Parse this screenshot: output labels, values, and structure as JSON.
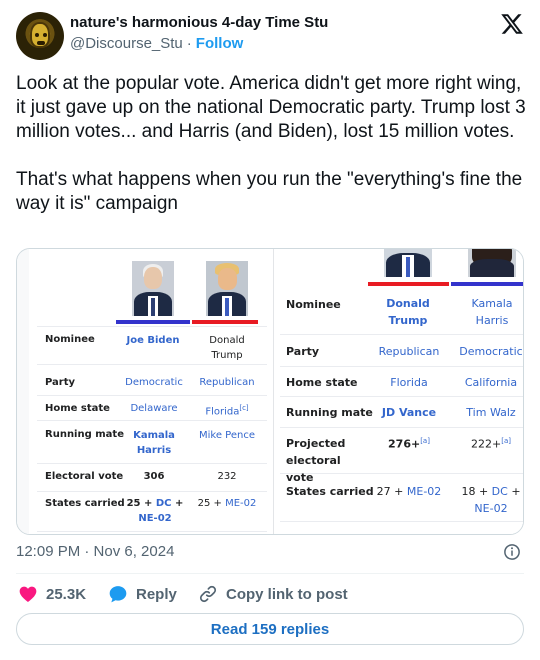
{
  "author": {
    "display_name": "nature's harmonious 4-day Time Stu",
    "handle": "@Discourse_Stu",
    "separator": "·",
    "follow_label": "Follow"
  },
  "post": {
    "text": "Look at the popular vote. America didn't get more right wing, it just gave up on the national Democratic party. Trump lost 3 million votes... and Harris (and Biden), lost 15 million votes.\n\nThat's what happens when you run the \"everything's fine the way it is\" campaign",
    "timestamp": "12:09 PM · Nov 6, 2024"
  },
  "media": {
    "left_table": {
      "candidates": [
        {
          "name": "Joe Biden",
          "bar_color": "#3333cc"
        },
        {
          "name": "Donald Trump",
          "bar_color": "#e81b23"
        }
      ],
      "rows": [
        {
          "label": "Nominee",
          "a": "Joe Biden",
          "b": "Donald Trump"
        },
        {
          "label": "Party",
          "a": "Democratic",
          "b": "Republican"
        },
        {
          "label": "Home state",
          "a": "Delaware",
          "b": "Florida",
          "b_note": "[c]"
        },
        {
          "label": "Running mate",
          "a": "Kamala Harris",
          "b": "Mike Pence"
        },
        {
          "label": "Electoral vote",
          "a": "306",
          "b": "232"
        },
        {
          "label": "States carried",
          "a_num": "25",
          "a_plus": "+",
          "a_dc": "DC",
          "a_plus2": "+",
          "a_me": "NE-02",
          "b_num": "25",
          "b_plus": "+",
          "b_me": "ME-02"
        }
      ]
    },
    "right_table": {
      "candidates": [
        {
          "name": "Donald Trump",
          "bar_color": "#e81b23"
        },
        {
          "name": "Kamala Harris",
          "bar_color": "#3333cc"
        }
      ],
      "rows": [
        {
          "label": "Nominee",
          "a": "Donald Trump",
          "b": "Kamala Harris"
        },
        {
          "label": "Party",
          "a": "Republican",
          "b": "Democratic"
        },
        {
          "label": "Home state",
          "a": "Florida",
          "b": "California"
        },
        {
          "label": "Running mate",
          "a": "JD Vance",
          "b": "Tim Walz"
        },
        {
          "label": "Projected electoral vote",
          "a": "276+",
          "a_note": "[a]",
          "b": "222+",
          "b_note": "[a]"
        },
        {
          "label": "States carried",
          "a_num": "27",
          "a_plus": "+",
          "a_me": "ME-02",
          "b_num": "18",
          "b_plus": "+",
          "b_dc": "DC",
          "b_plus2": "+",
          "b_me": "NE-02"
        }
      ]
    }
  },
  "actions": {
    "likes": "25.3K",
    "reply_label": "Reply",
    "copy_label": "Copy link to post",
    "read_replies": "Read 159 replies"
  },
  "colors": {
    "like": "#f91880",
    "reply": "#1d9bf0",
    "link": "#3366cc",
    "republican": "#e81b23",
    "democratic": "#3333cc"
  },
  "icons": [
    "x-logo-icon",
    "info-icon",
    "heart-icon",
    "reply-bubble-icon",
    "link-icon"
  ]
}
